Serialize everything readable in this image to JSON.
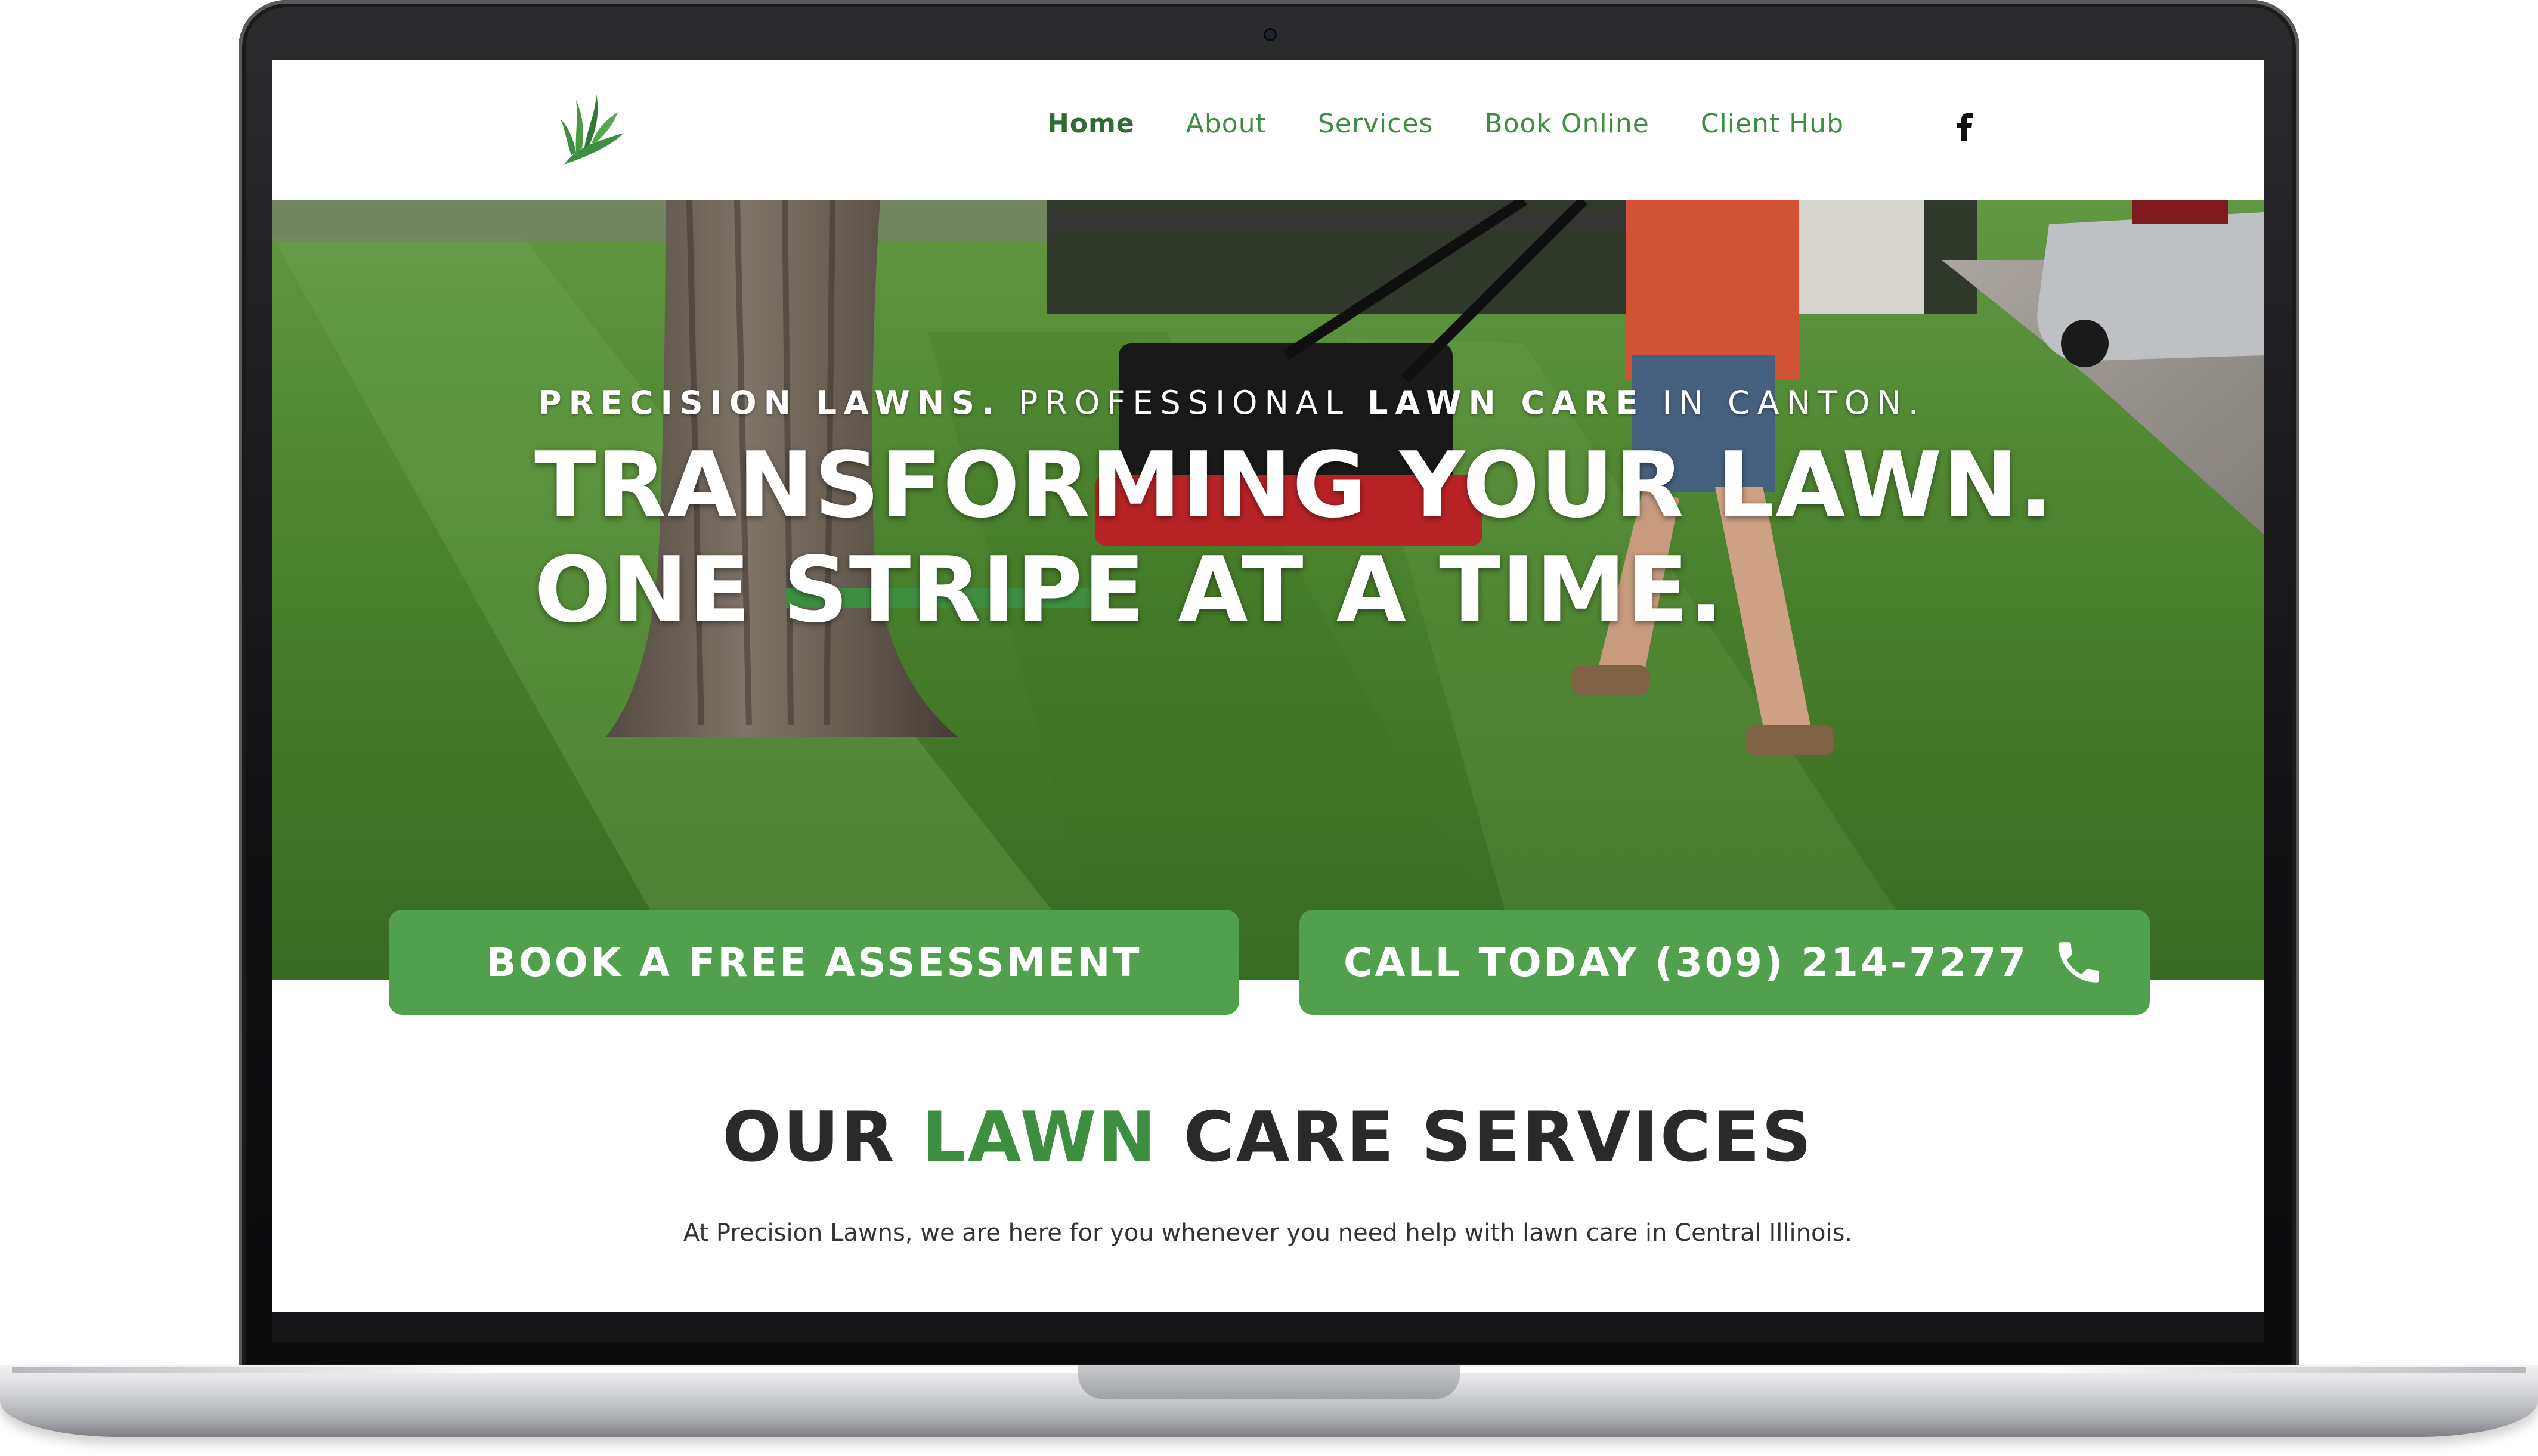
{
  "header": {
    "logo_icon": "grass-blade-logo-icon",
    "nav": [
      {
        "label": "Home",
        "active": true
      },
      {
        "label": "About",
        "active": false
      },
      {
        "label": "Services",
        "active": false
      },
      {
        "label": "Book Online",
        "active": false
      },
      {
        "label": "Client Hub",
        "active": false
      }
    ],
    "social_icon": "facebook-icon"
  },
  "hero": {
    "tagline": {
      "part1": "PRECISION LAWNS.",
      "part2": " PROFESSIONAL ",
      "part3": "LAWN CARE",
      "part4": " IN CANTON."
    },
    "headline_line1": "TRANSFORMING YOUR LAWN.",
    "headline_line2": "ONE STRIPE AT A TIME."
  },
  "cta": {
    "book_label": "BOOK A FREE ASSESSMENT",
    "call_label": "CALL TODAY (309) 214-7277",
    "call_icon": "phone-icon"
  },
  "services": {
    "title_part1": "OUR ",
    "title_accent": "LAWN",
    "title_part2": " CARE SERVICES",
    "subtitle": "At Precision Lawns, we are here for you whenever you need help with lawn care in Central Illinois."
  },
  "colors": {
    "brand_green": "#3e8e41",
    "button_green": "#51a04e",
    "dark_text": "#2a2a2a"
  }
}
